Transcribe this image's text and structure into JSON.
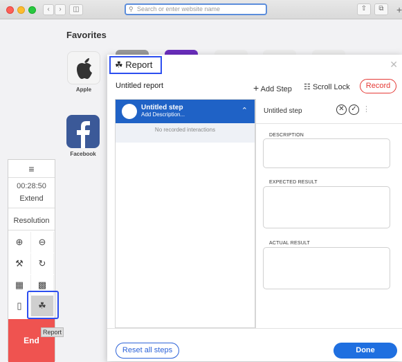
{
  "browser": {
    "url_placeholder": "Search or enter website name"
  },
  "favorites": {
    "title": "Favorites",
    "items": [
      {
        "label": "Apple",
        "icon": "apple-icon"
      },
      {
        "label": "Facebook",
        "icon": "facebook-icon"
      }
    ]
  },
  "toolbar": {
    "menu_icon": "hamburger-icon",
    "timer": "00:28:50",
    "extend_label": "Extend",
    "resolution_label": "Resolution",
    "end_label": "End",
    "tooltip": "Report",
    "tools": [
      "zoom-in-icon",
      "zoom-out-icon",
      "wrench-icon",
      "rotate-icon",
      "screenshot-icon",
      "video-icon",
      "device-icon",
      "report-icon"
    ]
  },
  "report": {
    "title": "Report",
    "name": "Untitled report",
    "add_step": "Add Step",
    "scroll_lock": "Scroll Lock",
    "record": "Record",
    "step": {
      "title": "Untitled step",
      "subtitle": "Add Description...",
      "empty_text": "No recorded interactions"
    },
    "detail": {
      "step_title": "Untitled step",
      "description_label": "DESCRIPTION",
      "expected_label": "EXPECTED RESULT",
      "actual_label": "ACTUAL RESULT"
    },
    "reset_label": "Reset all steps",
    "done_label": "Done"
  },
  "colors": {
    "accent_blue": "#1f62c6",
    "record_red": "#e53935",
    "end_red": "#ef5350",
    "highlight_blue": "#2c4ef0"
  }
}
